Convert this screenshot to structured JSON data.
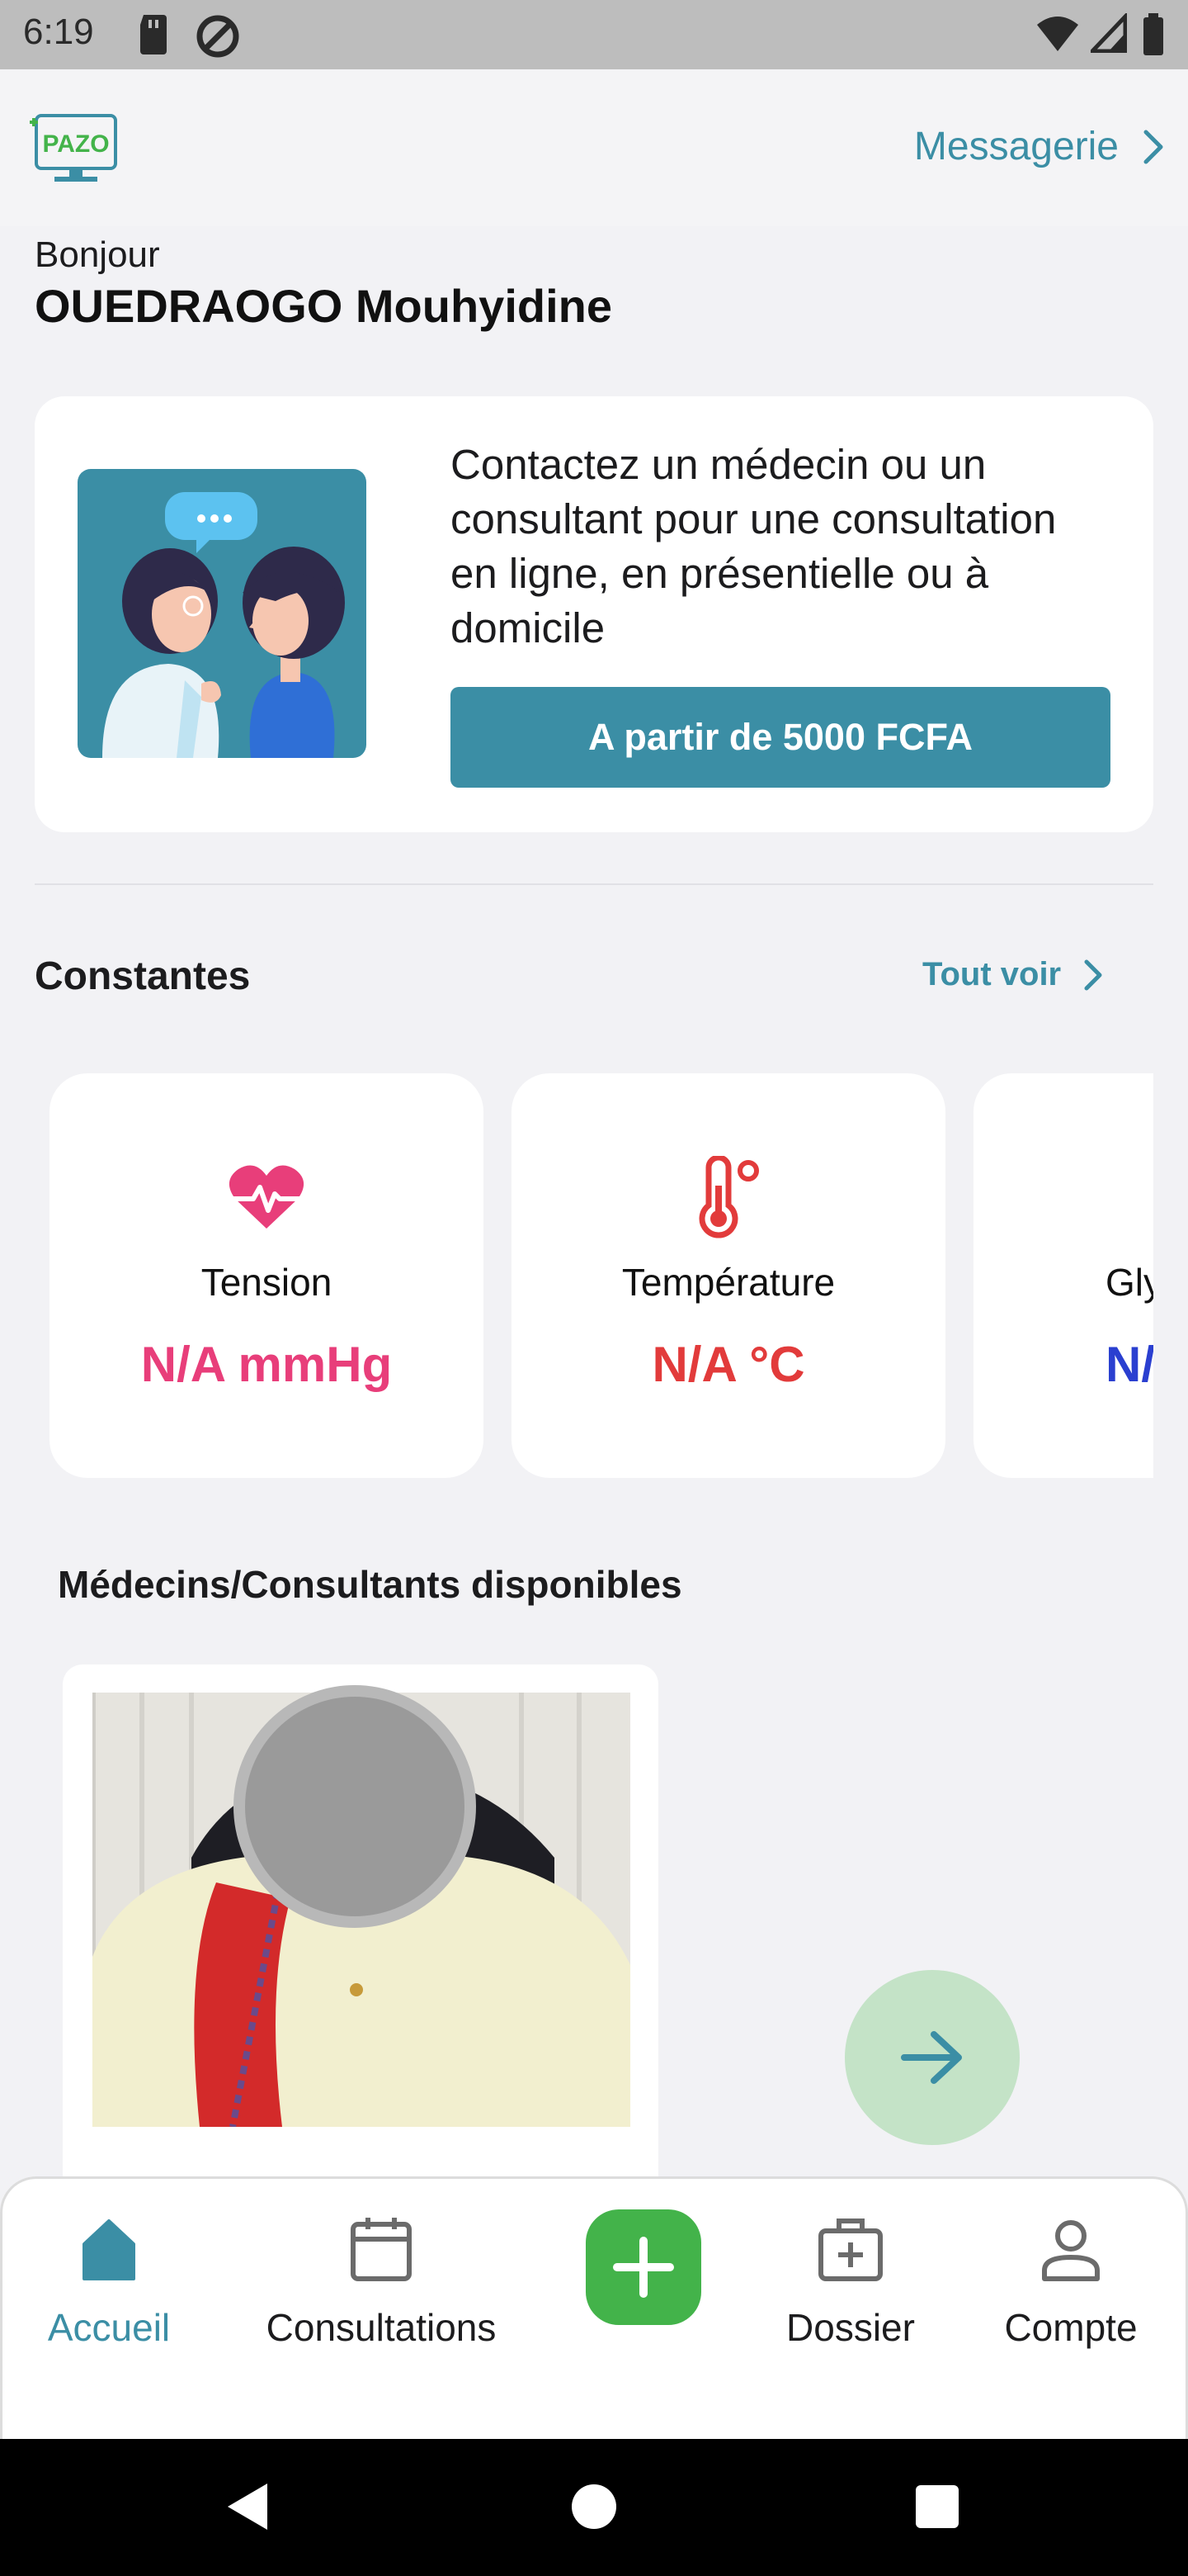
{
  "status_bar": {
    "time": "6:19",
    "icons": [
      "sd-card-icon",
      "data-saver-icon",
      "wifi-icon",
      "cell-signal-icon",
      "battery-icon"
    ]
  },
  "header": {
    "logo_text": "PAZO",
    "messagerie_label": "Messagerie"
  },
  "greeting": {
    "hello": "Bonjour",
    "user_name": "OUEDRAOGO Mouhyidine"
  },
  "promo": {
    "text": "Contactez un médecin ou un consultant pour une consultation en ligne, en présentielle ou à domicile",
    "button_label": "A partir de 5000 FCFA"
  },
  "constantes": {
    "title": "Constantes",
    "see_all_label": "Tout voir",
    "items": [
      {
        "name": "Tension",
        "value": "N/A mmHg",
        "color": "#e83e7a",
        "icon": "heartbeat-icon"
      },
      {
        "name": "Température",
        "value": "N/A °C",
        "color": "#e23b3b",
        "icon": "thermometer-icon"
      },
      {
        "name": "Gly",
        "value": "N/",
        "color": "#2a3fd0",
        "icon": "glycemia-icon"
      }
    ]
  },
  "doctors": {
    "title": "Médecins/Consultants disponibles"
  },
  "bottom_nav": {
    "items": [
      {
        "label": "Accueil",
        "icon": "home-icon",
        "active": true
      },
      {
        "label": "Consultations",
        "icon": "calendar-icon",
        "active": false
      },
      {
        "label": "Dossier",
        "icon": "medical-folder-icon",
        "active": false
      },
      {
        "label": "Compte",
        "icon": "account-icon",
        "active": false
      }
    ]
  },
  "colors": {
    "accent": "#3b8ea5",
    "active_nav": "#3b8ea5",
    "add_button": "#43b34a",
    "next_button": "#c4e3c7"
  }
}
